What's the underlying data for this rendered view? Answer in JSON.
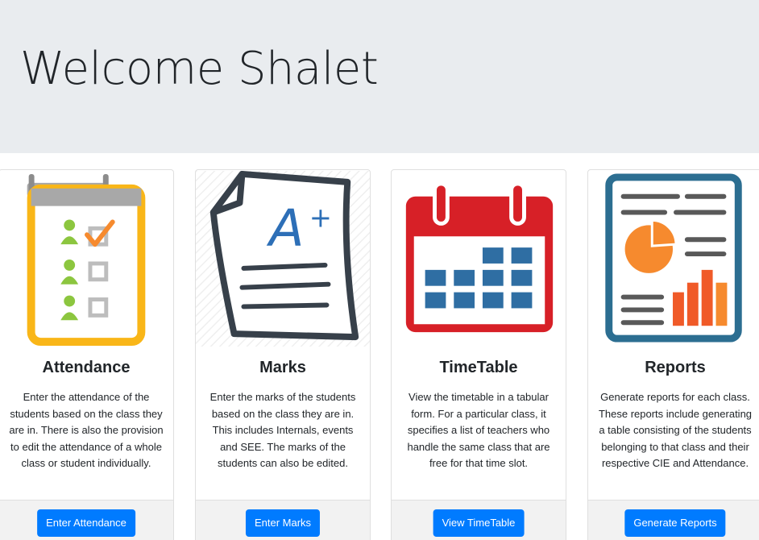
{
  "jumbotron": {
    "heading": "Welcome Shalet"
  },
  "cards": [
    {
      "title": "Attendance",
      "text": "Enter the attendance of the students based on the class they are in. There is also the provision to edit the attendance of a whole class or student individually.",
      "button": "Enter Attendance",
      "icon": "attendance-clipboard-icon"
    },
    {
      "title": "Marks",
      "text": "Enter the marks of the students based on the class they are in. This includes Internals, events and SEE. The marks of the students can also be edited.",
      "button": "Enter Marks",
      "icon": "marks-paper-icon"
    },
    {
      "title": "TimeTable",
      "text": "View the timetable in a tabular form. For a particular class, it specifies a list of teachers who handle the same class that are free for that time slot.",
      "button": "View TimeTable",
      "icon": "calendar-icon"
    },
    {
      "title": "Reports",
      "text": "Generate reports for each class. These reports include generating a table consisting of the students belonging to that class and their respective CIE and Attendance.",
      "button": "Generate Reports",
      "icon": "report-chart-icon"
    }
  ],
  "colors": {
    "primary": "#007bff",
    "jumbotron_bg": "#e9ecef",
    "attendance_yellow": "#f9b618",
    "marks_dark": "#37404a",
    "marks_blue": "#2d6fb7",
    "calendar_red": "#d72027",
    "calendar_blue": "#2f6ea3",
    "report_teal": "#2c6e91",
    "report_orange": "#f68a2e"
  }
}
